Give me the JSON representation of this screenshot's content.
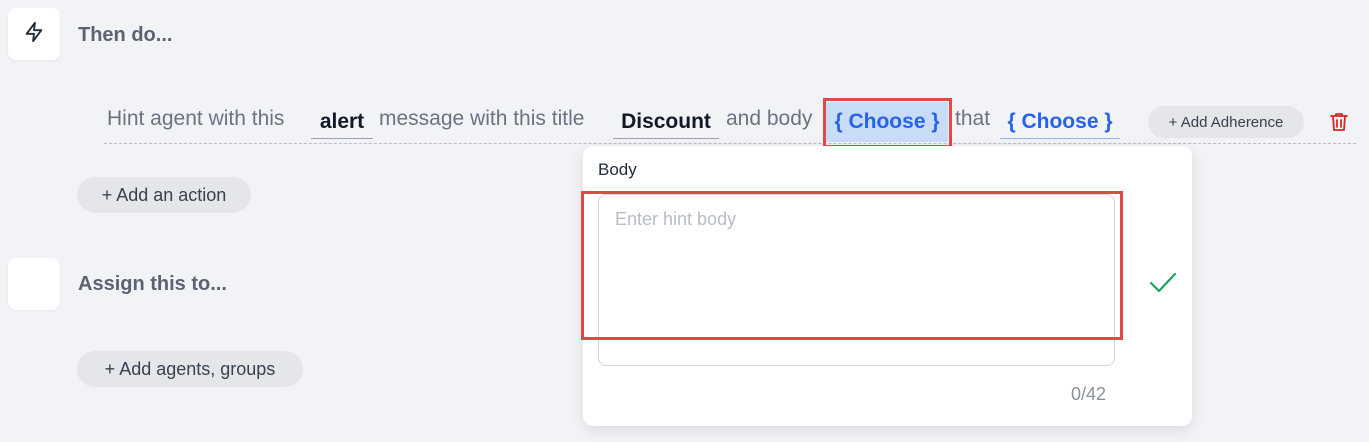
{
  "then_step": {
    "icon": "lightning-bolt-icon",
    "title": "Then do..."
  },
  "action_row": {
    "text_1": "Hint agent with this",
    "type_value": "alert",
    "text_2": "message with this title",
    "title_value": "Discount",
    "text_3": "and body",
    "body_choose": "{ Choose }",
    "text_4": "that",
    "that_choose": "{ Choose }",
    "add_adherence": "+ Add Adherence",
    "delete_icon": "trash-icon"
  },
  "add_action_label": "+ Add an action",
  "assign_step": {
    "title": "Assign this to..."
  },
  "add_agents_label": "+ Add agents, groups",
  "body_popover": {
    "label": "Body",
    "value": "",
    "placeholder": "Enter hint body",
    "char_count": "0/42",
    "confirm_icon": "checkmark-icon"
  },
  "colors": {
    "accent_blue": "#2563eb",
    "highlight_red": "#e34848",
    "check_green": "#22a060",
    "delete_red": "#dc2626"
  }
}
